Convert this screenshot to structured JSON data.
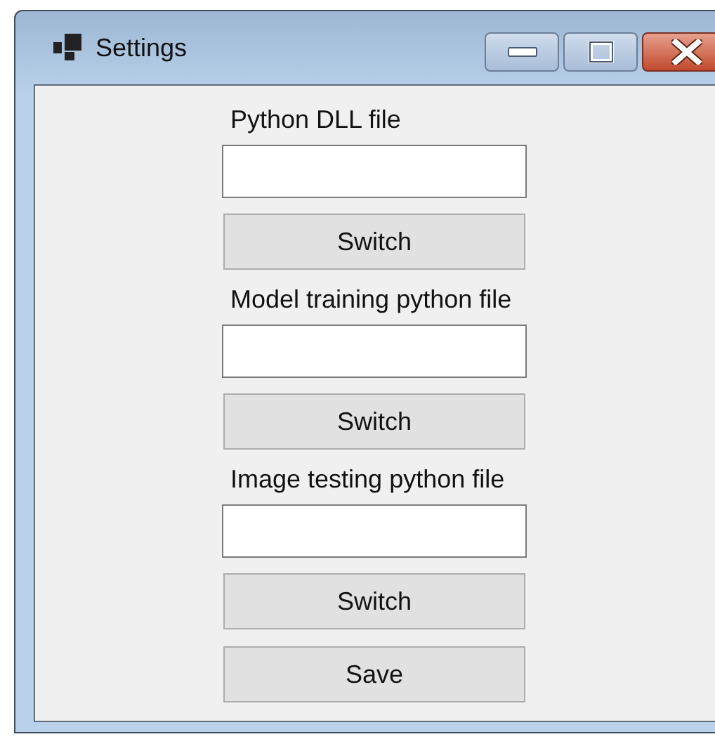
{
  "window": {
    "title": "Settings"
  },
  "sections": [
    {
      "label": "Python DLL file",
      "button": "Switch"
    },
    {
      "label": "Model training python file",
      "button": "Switch"
    },
    {
      "label": "Image testing python file",
      "button": "Switch"
    }
  ],
  "save_button": "Save"
}
